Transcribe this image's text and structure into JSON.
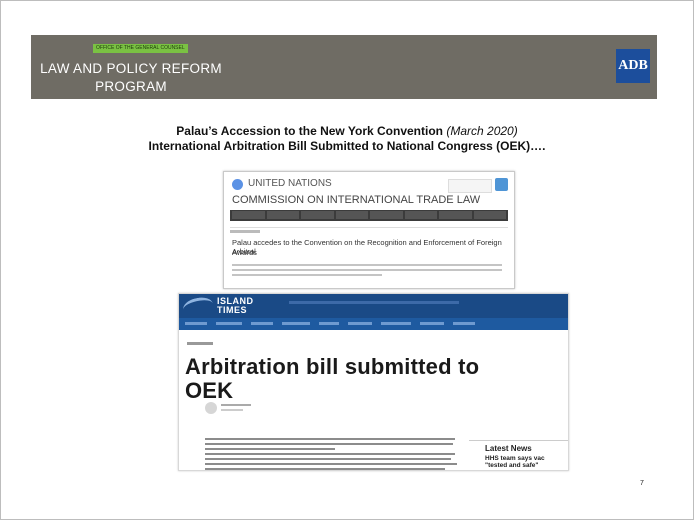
{
  "banner": {
    "tag": "OFFICE OF THE GENERAL COUNSEL",
    "program_line1": "LAW AND POLICY REFORM",
    "program_line2": "PROGRAM",
    "logo_text": "ADB",
    "bg_color": "#6f6c64",
    "logo_color": "#1c4e9c"
  },
  "title": {
    "line1_main": "Palau’s Accession to the New York Convention",
    "line1_date": "(March 2020)",
    "line2": "International Arbitration Bill Submitted to National Congress (OEK)…."
  },
  "un_screenshot": {
    "org": "UNITED NATIONS",
    "commission": "COMMISSION ON INTERNATIONAL TRADE LAW",
    "headline_line1": "Palau accedes to the Convention on the Recognition and Enforcement of Foreign Arbitral",
    "headline_line2": "Awards"
  },
  "article_screenshot": {
    "brand_line1": "ISLAND",
    "brand_line2": "TIMES",
    "headline_line1": "Arbitration bill submitted to",
    "headline_line2": "OEK",
    "sidebar_title": "Latest News",
    "sidebar_item_line1": "HHS team says vac",
    "sidebar_item_line2": "\"tested and safe\""
  },
  "page_number": "7"
}
